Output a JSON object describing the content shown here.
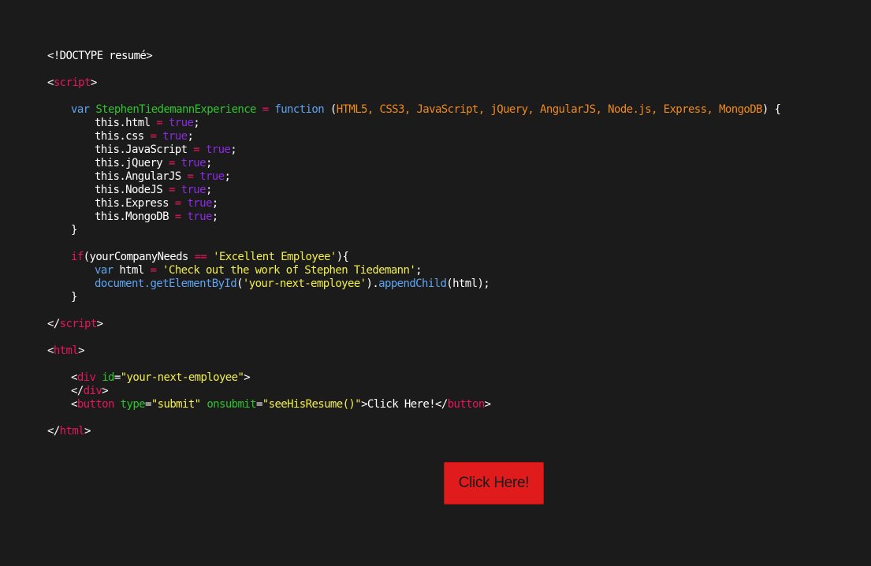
{
  "theme": {
    "background": "#1b1b1b",
    "plain": "#ffffff",
    "tag": "#e8165a",
    "keyword": "#5fa3f0",
    "function_name": "#2ec42e",
    "param": "#f08a1c",
    "boolean": "#8a2be2",
    "string": "#f2ee4a",
    "button_bg": "#e01b1b"
  },
  "code": {
    "l1": {
      "a": "<!DOCTYPE resumé>"
    },
    "l2": {
      "a": "<",
      "b": "script",
      "c": ">"
    },
    "l3": {
      "a": "var",
      "b": " ",
      "c": "StephenTiedemannExperience",
      "d": " = ",
      "e": "function",
      "f": " (",
      "g": "HTML5, CSS3, JavaScript, jQuery, AngularJS, Node.js, Express, MongoDB",
      "h": ") {"
    },
    "p1": {
      "a": "this.html",
      "b": " = ",
      "c": "true",
      "d": ";"
    },
    "p2": {
      "a": "this.css",
      "b": " = ",
      "c": "true",
      "d": ";"
    },
    "p3": {
      "a": "this.JavaScript",
      "b": " = ",
      "c": "true",
      "d": ";"
    },
    "p4": {
      "a": "this.jQuery",
      "b": " = ",
      "c": "true",
      "d": ";"
    },
    "p5": {
      "a": "this.AngularJS",
      "b": " = ",
      "c": "true",
      "d": ";"
    },
    "p6": {
      "a": "this.NodeJS",
      "b": " = ",
      "c": "true",
      "d": ";"
    },
    "p7": {
      "a": "this.Express",
      "b": " = ",
      "c": "true",
      "d": ";"
    },
    "p8": {
      "a": "this.MongoDB",
      "b": " = ",
      "c": "true",
      "d": ";"
    },
    "l4": {
      "a": "}"
    },
    "l5": {
      "a": "if",
      "b": "(yourCompanyNeeds ",
      "c": "==",
      "d": " ",
      "e": "'Excellent Employee'",
      "f": "){"
    },
    "l6": {
      "a": "var",
      "b": " html ",
      "c": "=",
      "d": " ",
      "e": "'Check out the work of Stephen Tiedemann'",
      "f": ";"
    },
    "l7": {
      "a": "document.",
      "b": "getElementById",
      "c": "(",
      "d": "'your-next-employee'",
      "e": ").",
      "f": "appendChild",
      "g": "(html);"
    },
    "l8": {
      "a": "}"
    },
    "l9": {
      "a": "</",
      "b": "script",
      "c": ">"
    },
    "l10": {
      "a": "<",
      "b": "html",
      "c": ">"
    },
    "l11": {
      "a": "<",
      "b": "div",
      "c": " ",
      "d": "id",
      "e": "=",
      "f": "\"your-next-employee\"",
      "g": ">"
    },
    "l12": {
      "a": "</",
      "b": "div",
      "c": ">"
    },
    "l13": {
      "a": "<",
      "b": "button",
      "c": " ",
      "d": "type",
      "e": "=",
      "f": "\"submit\"",
      "g": " ",
      "h": "onsubmit",
      "i": "=",
      "j": "\"seeHisResume()\"",
      "k": ">Click Here!</",
      "l": "button",
      "m": ">"
    },
    "l14": {
      "a": "</",
      "b": "html",
      "c": ">"
    }
  },
  "cta": {
    "label": "Click Here!"
  }
}
